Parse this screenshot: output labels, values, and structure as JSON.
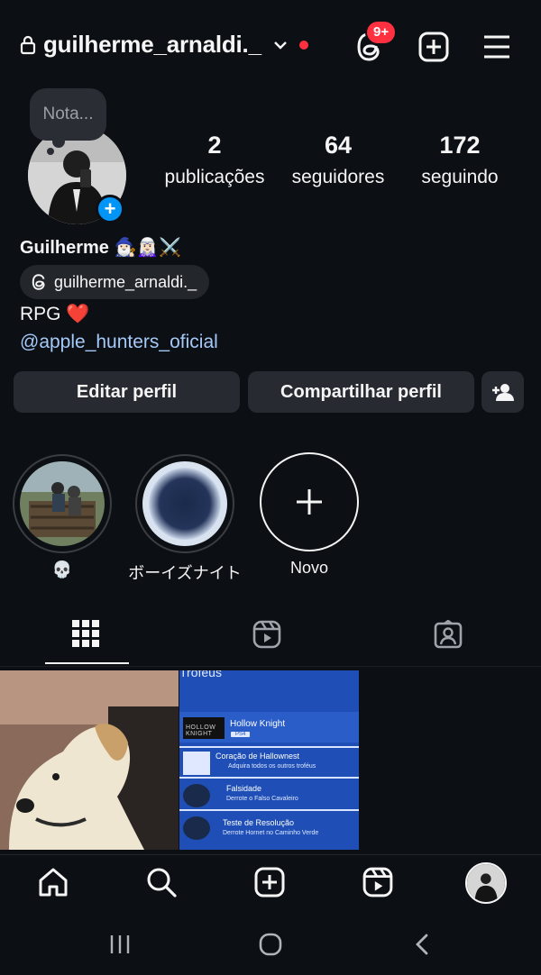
{
  "header": {
    "username": "guilherme_arnaldi._",
    "notification_badge": "9+",
    "icons": [
      "lock-icon",
      "chevron-down-icon",
      "threads-icon",
      "create-icon",
      "menu-icon"
    ]
  },
  "note": {
    "placeholder": "Nota..."
  },
  "stats": [
    {
      "value": "2",
      "label": "publicações"
    },
    {
      "value": "64",
      "label": "seguidores"
    },
    {
      "value": "172",
      "label": "seguindo"
    }
  ],
  "profile": {
    "full_name": "Guilherme 🧙🏻‍♂️🧝🏻‍♀️⚔️",
    "threads_handle": "guilherme_arnaldi._",
    "bio": "RPG ❤️",
    "link": "@apple_hunters_oficial"
  },
  "buttons": {
    "edit": "Editar perfil",
    "share": "Compartilhar perfil"
  },
  "highlights": [
    {
      "label": "💀"
    },
    {
      "label": "ボーイズナイト"
    },
    {
      "label": "Novo"
    }
  ],
  "posts": {
    "second": {
      "header": "Troféus",
      "game": "Hollow Knight",
      "platform": "PS4",
      "trophies": [
        {
          "title": "Coração de Hallownest",
          "desc": "Adquira todos os outros troféus"
        },
        {
          "title": "Falsidade",
          "desc": "Derrote o Falso Cavaleiro"
        },
        {
          "title": "Teste de Resolução",
          "desc": "Derrote Hornet no Caminho Verde"
        }
      ]
    }
  },
  "colors": {
    "background": "#0c0f14",
    "accent_blue": "#0095f6",
    "badge_red": "#ff3040",
    "link": "#a5c9f8",
    "button": "#272a30"
  }
}
